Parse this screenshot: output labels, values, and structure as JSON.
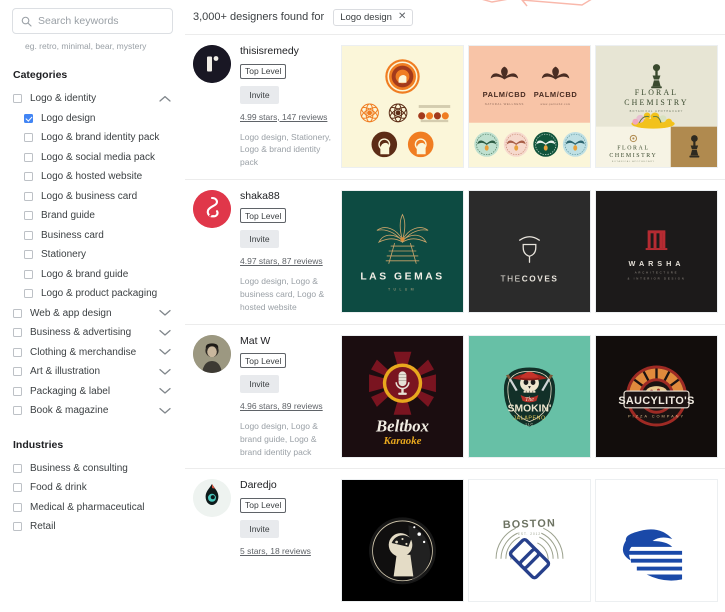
{
  "search": {
    "placeholder": "Search keywords",
    "value": "",
    "hint": "eg. retro, minimal, bear, mystery",
    "icon": "search-icon"
  },
  "sidebar": {
    "categories_title": "Categories",
    "industries_title": "Industries",
    "categories": [
      {
        "label": "Logo & identity",
        "checked": false,
        "chevron": "chevron-up-icon",
        "indent": false
      },
      {
        "label": "Logo design",
        "checked": true,
        "chevron": "",
        "indent": true
      },
      {
        "label": "Logo & brand identity pack",
        "checked": false,
        "chevron": "",
        "indent": true
      },
      {
        "label": "Logo & social media pack",
        "checked": false,
        "chevron": "",
        "indent": true
      },
      {
        "label": "Logo & hosted website",
        "checked": false,
        "chevron": "",
        "indent": true
      },
      {
        "label": "Logo & business card",
        "checked": false,
        "chevron": "",
        "indent": true
      },
      {
        "label": "Brand guide",
        "checked": false,
        "chevron": "",
        "indent": true
      },
      {
        "label": "Business card",
        "checked": false,
        "chevron": "",
        "indent": true
      },
      {
        "label": "Stationery",
        "checked": false,
        "chevron": "",
        "indent": true
      },
      {
        "label": "Logo & brand guide",
        "checked": false,
        "chevron": "",
        "indent": true
      },
      {
        "label": "Logo & product packaging",
        "checked": false,
        "chevron": "",
        "indent": true
      },
      {
        "label": "Web & app design",
        "checked": false,
        "chevron": "chevron-down-icon",
        "indent": false
      },
      {
        "label": "Business & advertising",
        "checked": false,
        "chevron": "chevron-down-icon",
        "indent": false
      },
      {
        "label": "Clothing & merchandise",
        "checked": false,
        "chevron": "chevron-down-icon",
        "indent": false
      },
      {
        "label": "Art & illustration",
        "checked": false,
        "chevron": "chevron-down-icon",
        "indent": false
      },
      {
        "label": "Packaging & label",
        "checked": false,
        "chevron": "chevron-down-icon",
        "indent": false
      },
      {
        "label": "Book & magazine",
        "checked": false,
        "chevron": "chevron-down-icon",
        "indent": false
      }
    ],
    "industries": [
      {
        "label": "Business & consulting",
        "checked": false
      },
      {
        "label": "Food & drink",
        "checked": false
      },
      {
        "label": "Medical & pharmaceutical",
        "checked": false
      },
      {
        "label": "Retail",
        "checked": false
      }
    ]
  },
  "results": {
    "count_text": "3,000+ designers found for",
    "filter_chip": {
      "label": "Logo design",
      "remove_icon": "close-icon"
    }
  },
  "designers": [
    {
      "name": "thisisremedy",
      "badge": "Top Level",
      "invite_label": "Invite",
      "rating": "4.99 stars, 147 reviews",
      "tags": "Logo design, Stationery, Logo & brand identity pack",
      "avatar_bg": "#191724",
      "works": [
        {
          "title": "Remedy Atomic brand marks",
          "bg": "#fbf6d9"
        },
        {
          "title": "PALM/CBD",
          "bg": "#f8c4a7"
        },
        {
          "title": "FLORAL CHEMISTRY",
          "bg": "#e9e7d6"
        }
      ]
    },
    {
      "name": "shaka88",
      "badge": "Top Level",
      "invite_label": "Invite",
      "rating": "4.97 stars, 87 reviews",
      "tags": "Logo design, Logo & business card, Logo & hosted website",
      "avatar_bg": "#e0374a",
      "works": [
        {
          "title": "LAS GEMAS TULUM",
          "bg": "#0d4b42"
        },
        {
          "title": "THE COVES",
          "bg": "#2b2b2b"
        },
        {
          "title": "WARSHA",
          "bg": "#1c1a1a"
        }
      ]
    },
    {
      "name": "Mat W",
      "badge": "Top Level",
      "invite_label": "Invite",
      "rating": "4.96 stars, 89 reviews",
      "tags": "Logo design, Logo & brand guide, Logo & brand identity pack",
      "avatar_bg": "#8d8a72",
      "works": [
        {
          "title": "Beltbox Karaoke",
          "bg": "#1b0d10"
        },
        {
          "title": "The Smokin' Jalapeno LLC",
          "bg": "#67c0a6"
        },
        {
          "title": "SAUCYLITO'S Pizza Company",
          "bg": "#120d0c"
        }
      ]
    },
    {
      "name": "Daredjo",
      "badge": "Top Level",
      "invite_label": "Invite",
      "rating": "5 stars, 18 reviews",
      "tags": "",
      "avatar_bg": "#eef3f0",
      "works": [
        {
          "title": "Astronaut emblem",
          "bg": "#000000"
        },
        {
          "title": "BOSTON EST.2012",
          "bg": "#ffffff"
        },
        {
          "title": "Blue eagle mark",
          "bg": "#ffffff"
        }
      ]
    }
  ],
  "colors": {
    "accent_blue": "#4285f4",
    "ornament": "#f9b8ab",
    "border": "#ececec",
    "muted_text": "#9aa0a6"
  }
}
